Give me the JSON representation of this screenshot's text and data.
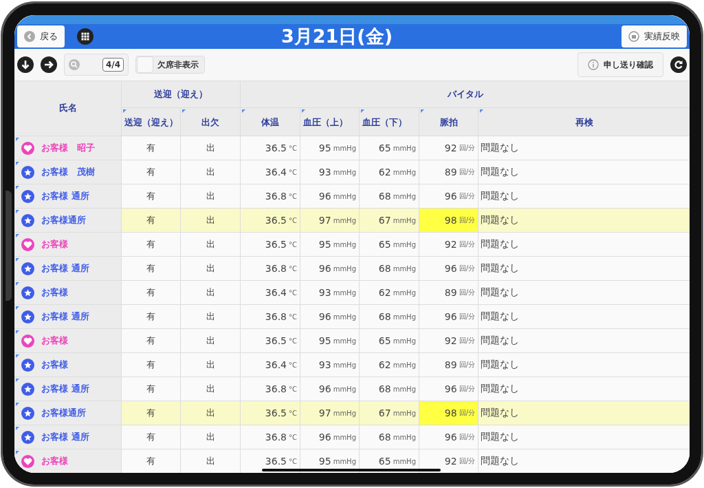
{
  "header": {
    "back_button": "戻る",
    "title": "3月21日(金)",
    "apply_button": "実績反映"
  },
  "toolbar": {
    "page_counter": "4/4",
    "hide_absent": {
      "label": "欠席非表示",
      "checked": false
    },
    "handover_button": "申し送り確認"
  },
  "table": {
    "name_header": "氏名",
    "pickup_group": "送迎（迎え）",
    "vitals_group": "バイタル",
    "columns": [
      "送迎（迎え）",
      "出欠",
      "体温",
      "血圧（上）",
      "血圧（下）",
      "脈拍",
      "再検"
    ],
    "rows": [
      {
        "kind": "heart",
        "color": "#ee44bb",
        "name": "お客様　昭子",
        "pickup": "有",
        "attendance": "出",
        "temp": "36.5",
        "temp_unit": "°C",
        "bp_high": "95",
        "bp_high_unit": "mmHg",
        "bp_low": "65",
        "bp_low_unit": "mmHg",
        "pulse": "92",
        "pulse_unit": "回/分",
        "recheck": "問題なし",
        "highlighted": false,
        "pulse_alert": false
      },
      {
        "kind": "star",
        "color": "#3f5de8",
        "name": "お客様　茂樹",
        "pickup": "有",
        "attendance": "出",
        "temp": "36.4",
        "temp_unit": "°C",
        "bp_high": "93",
        "bp_high_unit": "mmHg",
        "bp_low": "62",
        "bp_low_unit": "mmHg",
        "pulse": "89",
        "pulse_unit": "回/分",
        "recheck": "問題なし",
        "highlighted": false,
        "pulse_alert": false
      },
      {
        "kind": "star",
        "color": "#3f5de8",
        "name": "お客様 通所",
        "pickup": "有",
        "attendance": "出",
        "temp": "36.8",
        "temp_unit": "°C",
        "bp_high": "96",
        "bp_high_unit": "mmHg",
        "bp_low": "68",
        "bp_low_unit": "mmHg",
        "pulse": "96",
        "pulse_unit": "回/分",
        "recheck": "問題なし",
        "highlighted": false,
        "pulse_alert": false
      },
      {
        "kind": "star",
        "color": "#3f5de8",
        "name": "お客様通所",
        "pickup": "有",
        "attendance": "出",
        "temp": "36.5",
        "temp_unit": "°C",
        "bp_high": "97",
        "bp_high_unit": "mmHg",
        "bp_low": "67",
        "bp_low_unit": "mmHg",
        "pulse": "98",
        "pulse_unit": "回/分",
        "recheck": "問題なし",
        "highlighted": true,
        "pulse_alert": true
      },
      {
        "kind": "heart",
        "color": "#ee44bb",
        "name": "お客様",
        "pickup": "有",
        "attendance": "出",
        "temp": "36.5",
        "temp_unit": "°C",
        "bp_high": "95",
        "bp_high_unit": "mmHg",
        "bp_low": "65",
        "bp_low_unit": "mmHg",
        "pulse": "92",
        "pulse_unit": "回/分",
        "recheck": "問題なし",
        "highlighted": false,
        "pulse_alert": false
      },
      {
        "kind": "star",
        "color": "#3f5de8",
        "name": "お客様 通所",
        "pickup": "有",
        "attendance": "出",
        "temp": "36.8",
        "temp_unit": "°C",
        "bp_high": "96",
        "bp_high_unit": "mmHg",
        "bp_low": "68",
        "bp_low_unit": "mmHg",
        "pulse": "96",
        "pulse_unit": "回/分",
        "recheck": "問題なし",
        "highlighted": false,
        "pulse_alert": false
      },
      {
        "kind": "star",
        "color": "#3f5de8",
        "name": "お客様",
        "pickup": "有",
        "attendance": "出",
        "temp": "36.4",
        "temp_unit": "°C",
        "bp_high": "93",
        "bp_high_unit": "mmHg",
        "bp_low": "62",
        "bp_low_unit": "mmHg",
        "pulse": "89",
        "pulse_unit": "回/分",
        "recheck": "問題なし",
        "highlighted": false,
        "pulse_alert": false
      },
      {
        "kind": "star",
        "color": "#3f5de8",
        "name": "お客様 通所",
        "pickup": "有",
        "attendance": "出",
        "temp": "36.8",
        "temp_unit": "°C",
        "bp_high": "96",
        "bp_high_unit": "mmHg",
        "bp_low": "68",
        "bp_low_unit": "mmHg",
        "pulse": "96",
        "pulse_unit": "回/分",
        "recheck": "問題なし",
        "highlighted": false,
        "pulse_alert": false
      },
      {
        "kind": "heart",
        "color": "#ee44bb",
        "name": "お客様",
        "pickup": "有",
        "attendance": "出",
        "temp": "36.5",
        "temp_unit": "°C",
        "bp_high": "95",
        "bp_high_unit": "mmHg",
        "bp_low": "65",
        "bp_low_unit": "mmHg",
        "pulse": "92",
        "pulse_unit": "回/分",
        "recheck": "問題なし",
        "highlighted": false,
        "pulse_alert": false
      },
      {
        "kind": "star",
        "color": "#3f5de8",
        "name": "お客様",
        "pickup": "有",
        "attendance": "出",
        "temp": "36.4",
        "temp_unit": "°C",
        "bp_high": "93",
        "bp_high_unit": "mmHg",
        "bp_low": "62",
        "bp_low_unit": "mmHg",
        "pulse": "89",
        "pulse_unit": "回/分",
        "recheck": "問題なし",
        "highlighted": false,
        "pulse_alert": false
      },
      {
        "kind": "star",
        "color": "#3f5de8",
        "name": "お客様 通所",
        "pickup": "有",
        "attendance": "出",
        "temp": "36.8",
        "temp_unit": "°C",
        "bp_high": "96",
        "bp_high_unit": "mmHg",
        "bp_low": "68",
        "bp_low_unit": "mmHg",
        "pulse": "96",
        "pulse_unit": "回/分",
        "recheck": "問題なし",
        "highlighted": false,
        "pulse_alert": false
      },
      {
        "kind": "star",
        "color": "#3f5de8",
        "name": "お客様通所",
        "pickup": "有",
        "attendance": "出",
        "temp": "36.5",
        "temp_unit": "°C",
        "bp_high": "97",
        "bp_high_unit": "mmHg",
        "bp_low": "67",
        "bp_low_unit": "mmHg",
        "pulse": "98",
        "pulse_unit": "回/分",
        "recheck": "問題なし",
        "highlighted": true,
        "pulse_alert": true
      },
      {
        "kind": "star",
        "color": "#3f5de8",
        "name": "お客様 通所",
        "pickup": "有",
        "attendance": "出",
        "temp": "36.8",
        "temp_unit": "°C",
        "bp_high": "96",
        "bp_high_unit": "mmHg",
        "bp_low": "68",
        "bp_low_unit": "mmHg",
        "pulse": "96",
        "pulse_unit": "回/分",
        "recheck": "問題なし",
        "highlighted": false,
        "pulse_alert": false
      },
      {
        "kind": "heart",
        "color": "#ee44bb",
        "name": "お客様",
        "pickup": "有",
        "attendance": "出",
        "temp": "36.5",
        "temp_unit": "°C",
        "bp_high": "95",
        "bp_high_unit": "mmHg",
        "bp_low": "65",
        "bp_low_unit": "mmHg",
        "pulse": "92",
        "pulse_unit": "回/分",
        "recheck": "問題なし",
        "highlighted": false,
        "pulse_alert": false
      }
    ]
  }
}
